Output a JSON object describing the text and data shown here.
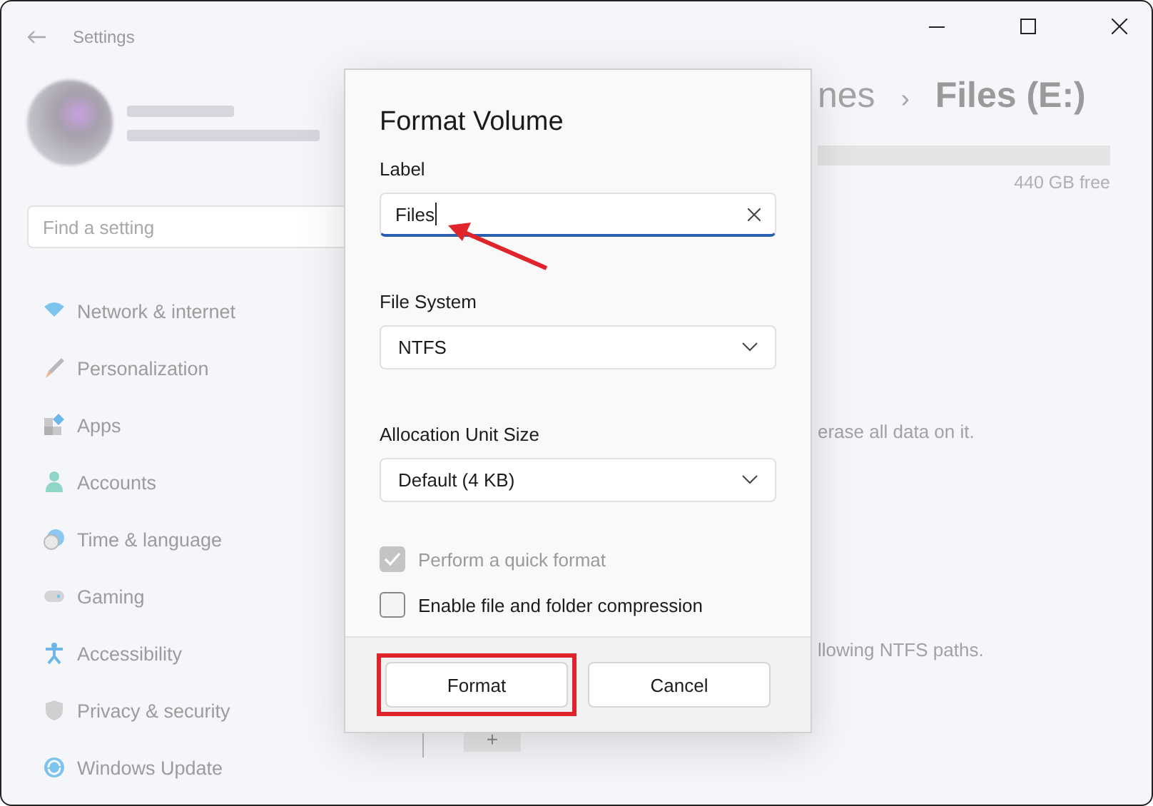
{
  "window": {
    "title": "Settings"
  },
  "sidebar": {
    "search": {
      "placeholder": "Find a setting"
    },
    "items": [
      {
        "label": "Network & internet"
      },
      {
        "label": "Personalization"
      },
      {
        "label": "Apps"
      },
      {
        "label": "Accounts"
      },
      {
        "label": "Time & language"
      },
      {
        "label": "Gaming"
      },
      {
        "label": "Accessibility"
      },
      {
        "label": "Privacy & security"
      },
      {
        "label": "Windows Update"
      }
    ]
  },
  "main": {
    "breadcrumb": [
      "nes",
      "›",
      "Files (E:)"
    ],
    "storage_free": "440 GB free",
    "format_text": "erase all data on it.",
    "paths_text": "llowing NTFS paths.",
    "add_button": "+"
  },
  "dialog": {
    "title": "Format Volume",
    "fields": [
      {
        "kind": "text",
        "label": "Label",
        "value": "Files"
      },
      {
        "kind": "dropdown",
        "label": "File System",
        "value": "NTFS"
      },
      {
        "kind": "dropdown",
        "label": "Allocation Unit Size",
        "value": "Default (4 KB)"
      }
    ],
    "checkboxes": [
      {
        "label": "Perform a quick format",
        "checked": true,
        "disabled": true
      },
      {
        "label": "Enable file and folder compression",
        "checked": false,
        "disabled": false
      }
    ],
    "buttons": [
      {
        "label": "Format",
        "highlighted": true
      },
      {
        "label": "Cancel",
        "highlighted": false
      }
    ]
  }
}
